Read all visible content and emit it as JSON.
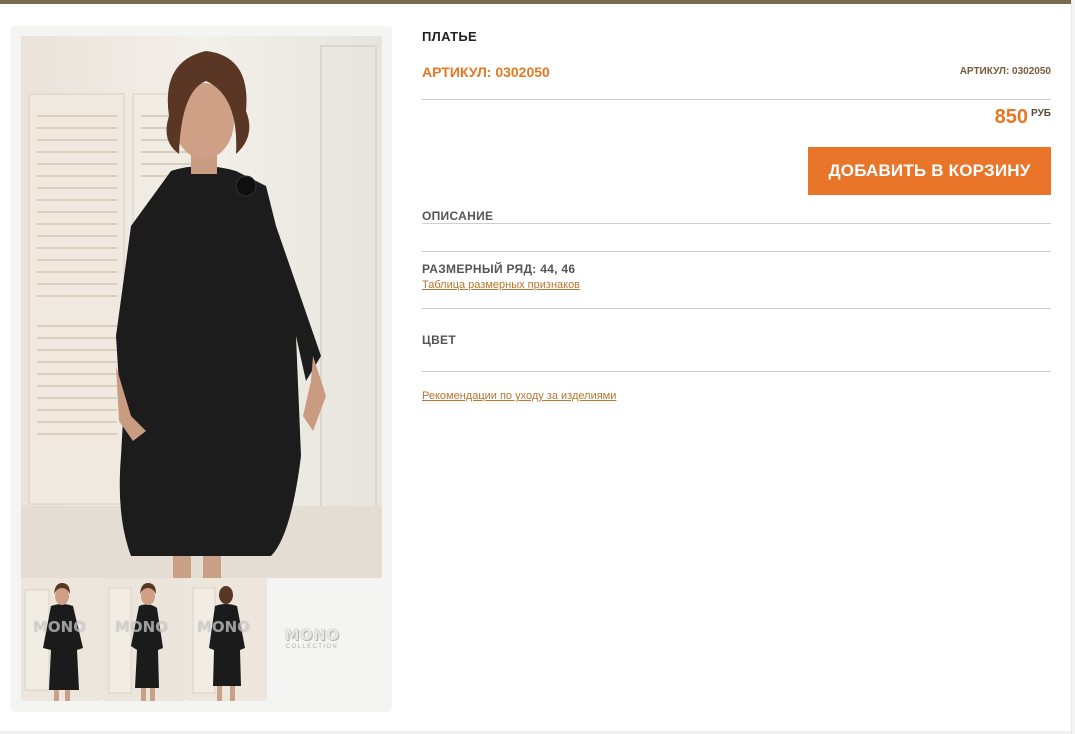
{
  "product": {
    "title": "ПЛАТЬЕ",
    "sku_label": "АРТИКУЛ: 0302050",
    "sku_label_small": "АРТИКУЛ: 0302050",
    "price": "850",
    "currency": "РУБ",
    "add_to_cart": "ДОБАВИТЬ В КОРЗИНУ"
  },
  "sections": {
    "description": "ОПИСАНИЕ",
    "sizes": "РАЗМЕРНЫЙ РЯД: 44, 46",
    "size_table_link": "Таблица размерных признаков",
    "color": "ЦВЕТ",
    "care_link": "Рекомендации по уходу за изделиями"
  },
  "gallery": {
    "watermark": "MONO",
    "logo_text": "MONO",
    "logo_sub": "COLLECTION"
  },
  "colors": {
    "accent": "#e8752a",
    "link": "#b8762f",
    "top_bar": "#7a6a52"
  }
}
